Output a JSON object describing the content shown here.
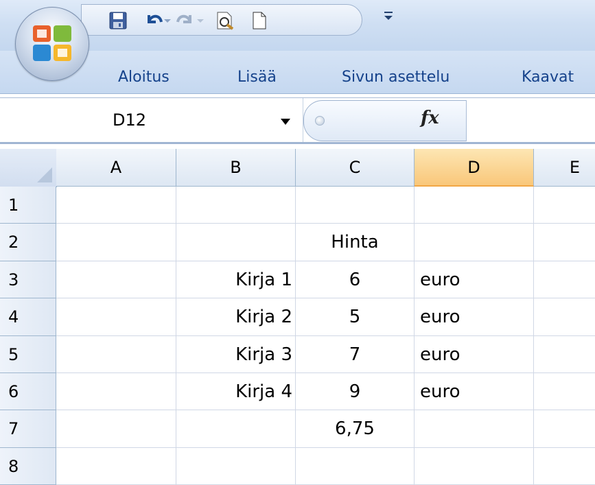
{
  "ribbon": {
    "tabs": [
      "Aloitus",
      "Lisää",
      "Sivun asettelu",
      "Kaavat"
    ]
  },
  "formula_bar": {
    "name_box": "D12",
    "fx_label": "fx",
    "formula_value": ""
  },
  "grid": {
    "columns": [
      "A",
      "B",
      "C",
      "D",
      "E"
    ],
    "selected_column": "D",
    "rows": [
      "1",
      "2",
      "3",
      "4",
      "5",
      "6",
      "7",
      "8"
    ],
    "cells": {
      "C2": "Hinta",
      "B3": "Kirja 1",
      "C3": "6",
      "D3": "euro",
      "B4": "Kirja 2",
      "C4": "5",
      "D4": "euro",
      "B5": "Kirja 3",
      "C5": "7",
      "D5": "euro",
      "B6": "Kirja 4",
      "C6": "9",
      "D6": "euro",
      "C7": "6,75"
    }
  },
  "colors": {
    "ribbon_text": "#15428b",
    "selected_header": "#f9c77a",
    "gridline": "#d0d7e5"
  }
}
